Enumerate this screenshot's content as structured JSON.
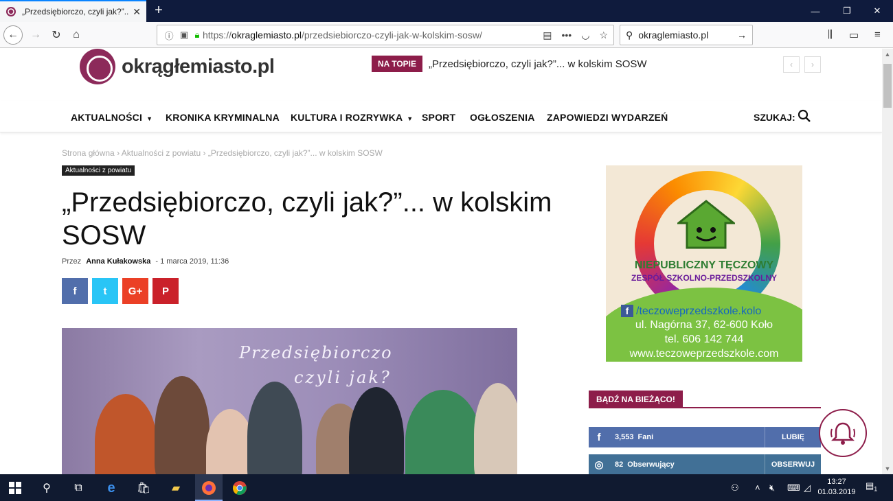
{
  "browser": {
    "tab_title": "„Przedsiębiorczo, czyli jak?”... w",
    "url_prefix": "https://",
    "url_domain": "okraglemiasto.pl",
    "url_path": "/przedsiebiorczo-czyli-jak-w-kolskim-sosw/",
    "search_value": "okraglemiasto.pl"
  },
  "site": {
    "logo_text": "okrągłemiasto.pl",
    "hot_label": "NA TOPIE",
    "hot_title": "„Przedsiębiorczo, czyli jak?”... w kolskim SOSW",
    "menu": [
      {
        "label": "AKTUALNOŚCI"
      },
      {
        "label": "KRONIKA KRYMINALNA"
      },
      {
        "label": "KULTURA I ROZRYWKA"
      },
      {
        "label": "SPORT"
      },
      {
        "label": "OGŁOSZENIA"
      },
      {
        "label": "ZAPOWIEDZI WYDARZEŃ"
      }
    ],
    "search_label": "SZUKAJ:"
  },
  "article": {
    "breadcrumb": [
      "Strona główna",
      "Aktualności z powiatu",
      "„Przedsiębiorczo, czyli jak?”... w kolskim SOSW"
    ],
    "category": "Aktualności z powiatu",
    "title": "„Przedsiębiorczo, czyli jak?”... w kolskim SOSW",
    "by_label": "Przez",
    "author": "Anna Kułakowska",
    "date": "1 marca 2019, 11:36",
    "photo_caption_1": "Przedsiębiorczo",
    "photo_caption_2": "czyli jak?",
    "share": [
      "f",
      "t",
      "G+",
      "P"
    ]
  },
  "sidebar": {
    "ad": {
      "url_arc": "www.teczoweprzedszkole.com",
      "heading_1": "NIEPUBLICZNY TĘCZOWY",
      "heading_2": "ZESPÓŁ SZKOLNO-PRZEDSZKOLNY",
      "facebook": "/teczoweprzedszkole.kolo",
      "address": "ul. Nagórna 37, 62-600 Koło",
      "phone": "tel. 606 142 744",
      "website": "www.teczoweprzedszkole.com"
    },
    "stay_label": "BĄDŹ NA BIEŻĄCO!",
    "social": [
      {
        "icon": "f",
        "count": "3,553",
        "label": "Fani",
        "action": "LUBIĘ",
        "color": "#516eab"
      },
      {
        "icon": "◎",
        "count": "82",
        "label": "Obserwujący",
        "action": "OBSERWUJ",
        "color": "#417096"
      }
    ]
  },
  "colors": {
    "accent": "#8d1d4a",
    "facebook": "#516eab",
    "twitter": "#29c5f6",
    "google": "#eb4026",
    "pinterest": "#ca212a"
  },
  "taskbar": {
    "time": "13:27",
    "date": "01.03.2019",
    "notification_count": "1"
  }
}
